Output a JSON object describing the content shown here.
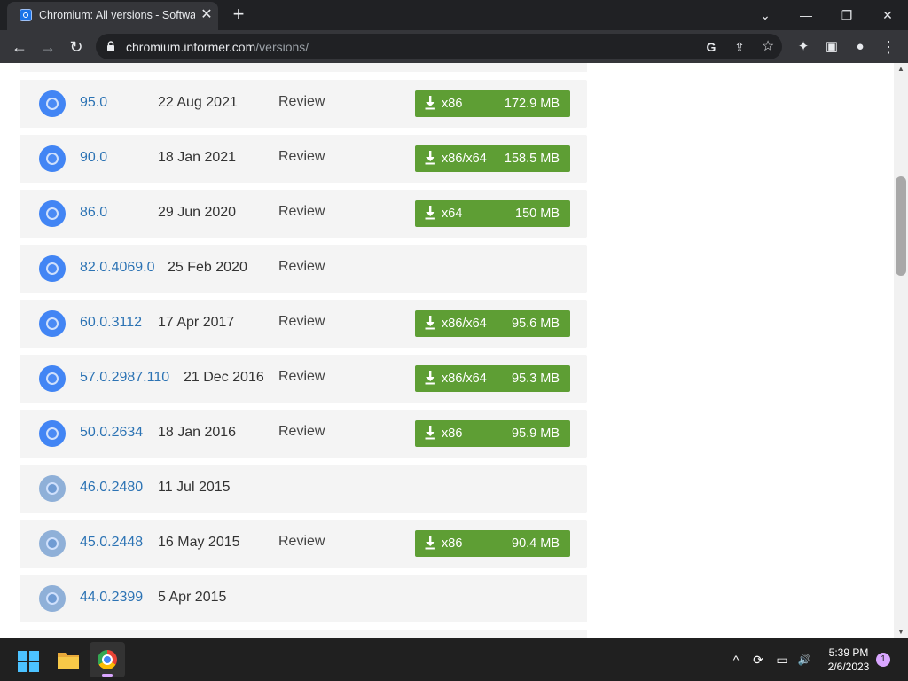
{
  "browser": {
    "tab_title": "Chromium: All versions - Software Informer",
    "tab_close": "✕",
    "new_tab": "+",
    "url_host": "chromium.informer.com",
    "url_path": "/versions/"
  },
  "icons": {
    "minimize": "—",
    "restore": "❐",
    "close": "✕",
    "chevron": "⌄",
    "back": "←",
    "forward": "→",
    "reload": "↻",
    "google": "G",
    "share": "⇪",
    "star": "☆",
    "extensions": "✦",
    "sidepanel": "▣",
    "profile": "●",
    "menu": "⋮"
  },
  "versions": [
    {
      "version": "95.0",
      "date": "22 Aug 2021",
      "review": "Review",
      "arch": "x86",
      "size": "172.9 MB"
    },
    {
      "version": "90.0",
      "date": "18 Jan 2021",
      "review": "Review",
      "arch": "x86/x64",
      "size": "158.5 MB"
    },
    {
      "version": "86.0",
      "date": "29 Jun 2020",
      "review": "Review",
      "arch": "x64",
      "size": "150 MB"
    },
    {
      "version": "82.0.4069.0",
      "date": "25 Feb 2020",
      "review": "Review"
    },
    {
      "version": "60.0.3112",
      "date": "17 Apr 2017",
      "review": "Review",
      "arch": "x86/x64",
      "size": "95.6 MB"
    },
    {
      "version": "57.0.2987.110",
      "date": "21 Dec 2016",
      "review": "Review",
      "arch": "x86/x64",
      "size": "95.3 MB"
    },
    {
      "version": "50.0.2634",
      "date": "18 Jan 2016",
      "review": "Review",
      "arch": "x86",
      "size": "95.9 MB"
    },
    {
      "version": "46.0.2480",
      "date": "11 Jul 2015"
    },
    {
      "version": "45.0.2448",
      "date": "16 May 2015",
      "review": "Review",
      "arch": "x86",
      "size": "90.4 MB"
    },
    {
      "version": "44.0.2399",
      "date": "5 Apr 2015"
    }
  ],
  "scroll": {
    "up": "▲",
    "down": "▼"
  },
  "taskbar": {
    "time": "5:39 PM",
    "date": "2/6/2023",
    "notifications": "1",
    "tray_chevron": "^",
    "tray_sync": "⟳",
    "tray_network": "▭",
    "tray_volume": "🔊"
  }
}
